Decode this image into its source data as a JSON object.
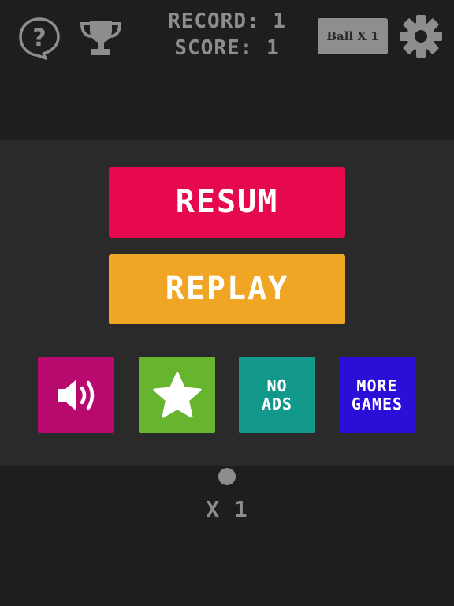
{
  "header": {
    "record_text": "RECORD: 1",
    "score_text": "SCORE: 1",
    "ball_button_label": "Ball X 1",
    "help_icon": "help-icon",
    "trophy_icon": "trophy-icon",
    "settings_icon": "gear-icon"
  },
  "menu": {
    "resume_label": "RESUM",
    "replay_label": "REPLAY",
    "sound_icon": "speaker-icon",
    "rate_icon": "star-icon",
    "no_ads_label": "NO\nADS",
    "more_games_label": "MORE\nGAMES"
  },
  "footer": {
    "multiplier_text": "X 1"
  },
  "colors": {
    "background": "#1e1e1f",
    "panel": "#2a2a2b",
    "resume": "#e6094e",
    "replay": "#f0a624",
    "sound": "#b8096f",
    "rate": "#67b42e",
    "no_ads": "#11988b",
    "more_games": "#2c0fd6",
    "muted_gray": "#8d8d8d"
  }
}
